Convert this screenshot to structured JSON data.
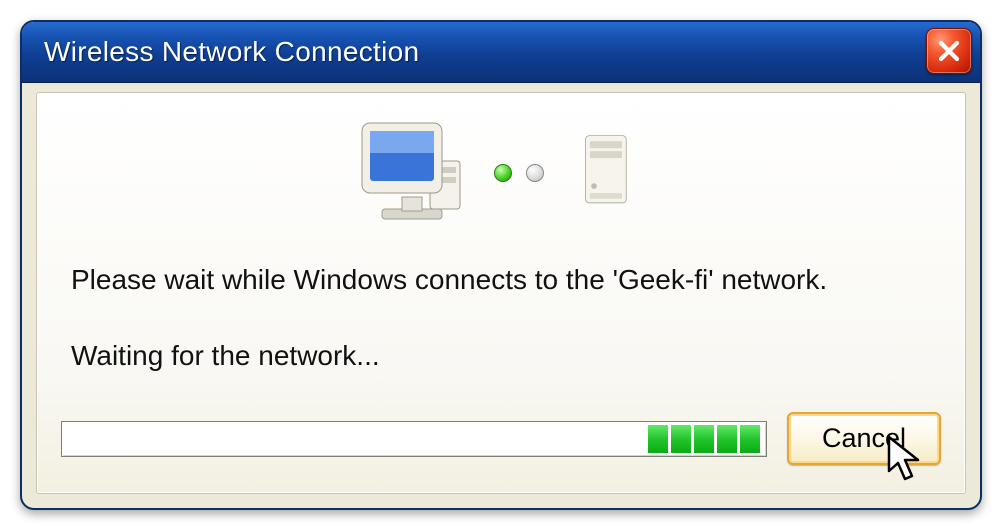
{
  "dialog": {
    "title": "Wireless Network Connection",
    "message": "Please wait while Windows connects to the 'Geek-fi' network.",
    "status": "Waiting for the network...",
    "cancel_label": "Cancel",
    "progress_blocks": 5
  },
  "icons": {
    "computer": "computer-icon",
    "server": "server-icon",
    "close": "close-icon",
    "cursor": "cursor-icon"
  },
  "colors": {
    "titlebar_accent": "#1855b5",
    "panel_bg": "#f9f8f3",
    "progress_block": "#23c52c",
    "cancel_focus": "#e2a63a"
  }
}
